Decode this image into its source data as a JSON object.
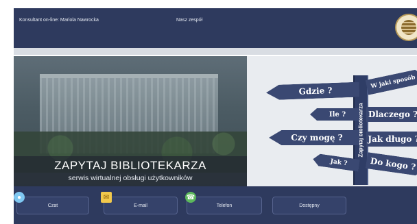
{
  "header": {
    "consultant": "Konsultant on-line: Mariola Nawrocka",
    "team_link": "Nasz zespół"
  },
  "hero": {
    "title": "ZAPYTAJ BIBLIOTEKARZA",
    "subtitle": "serwis wirtualnej obsługi użytkowników"
  },
  "signpost": {
    "pole_label": "Zapytaj bibliotekarza",
    "signs": {
      "gdzie": "Gdzie ?",
      "w_jaki_sposob": "W jaki sposób",
      "ile": "Ile ?",
      "dlaczego": "Dlaczego ?",
      "czy_moge": "Czy mogę ?",
      "jak_dlugo": "Jak długo ?",
      "jak": "Jak ?",
      "do_kogo": "Do kogo ?"
    }
  },
  "nav": {
    "chat": "Czat",
    "email": "E-mail",
    "phone": "Telefon",
    "status": "Dostępny"
  },
  "icons": {
    "chat": "chat-bubble-icon",
    "email": "envelope-icon",
    "phone": "phone-icon"
  }
}
